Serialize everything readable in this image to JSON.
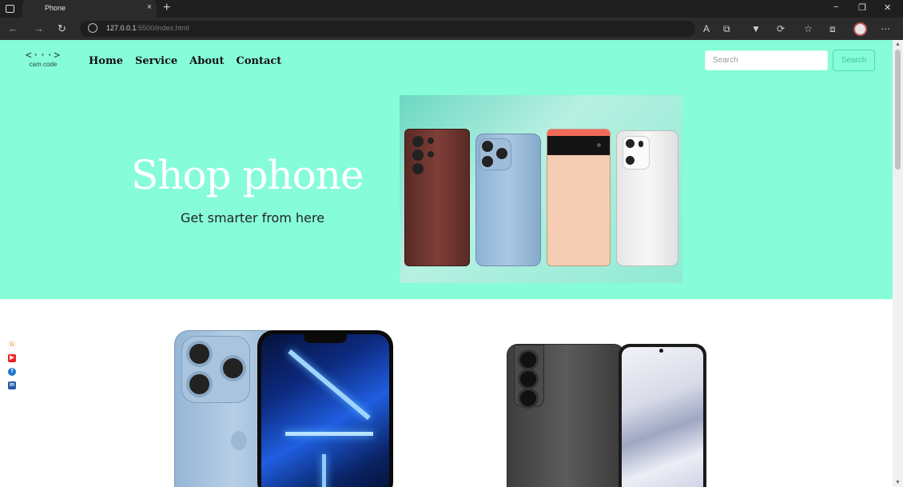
{
  "browser": {
    "tab_title": "Phone",
    "tab_close": "×",
    "new_tab": "+",
    "url_host": "127.0.0.1",
    "url_rest": ":5500/index.html",
    "window_controls": [
      "−",
      "❐",
      "✕"
    ]
  },
  "nav": {
    "logo_mark": "<···>",
    "logo_text": "cam code",
    "links": [
      "Home",
      "Service",
      "About",
      "Contact"
    ]
  },
  "search": {
    "placeholder": "Search",
    "button": "Search"
  },
  "hero": {
    "title": "Shop phone",
    "subtitle": "Get smarter from here"
  },
  "social": [
    "google-icon",
    "youtube-icon",
    "facebook-icon",
    "linkedin-icon"
  ],
  "colors": {
    "hero_bg": "#86fcd9",
    "search_accent": "#3cc896"
  }
}
